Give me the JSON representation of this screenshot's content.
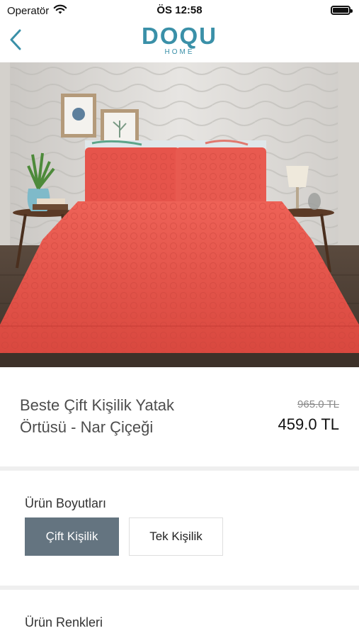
{
  "status_bar": {
    "carrier": "Operatör",
    "time": "ÖS 12:58"
  },
  "header": {
    "brand": "DOQU",
    "brand_sub": "HOME"
  },
  "product": {
    "title": "Beste Çift Kişilik Yatak Örtüsü - Nar Çiçeği",
    "old_price": "965.0 TL",
    "price": "459.0 TL"
  },
  "sizes": {
    "label": "Ürün Boyutları",
    "options": [
      {
        "label": "Çift Kişilik",
        "selected": true
      },
      {
        "label": "Tek Kişilik",
        "selected": false
      }
    ]
  },
  "colors": {
    "label": "Ürün Renkleri"
  },
  "theme": {
    "accent": "#3a90a8",
    "selected_bg": "#647480",
    "bedspread": "#e8584f"
  }
}
